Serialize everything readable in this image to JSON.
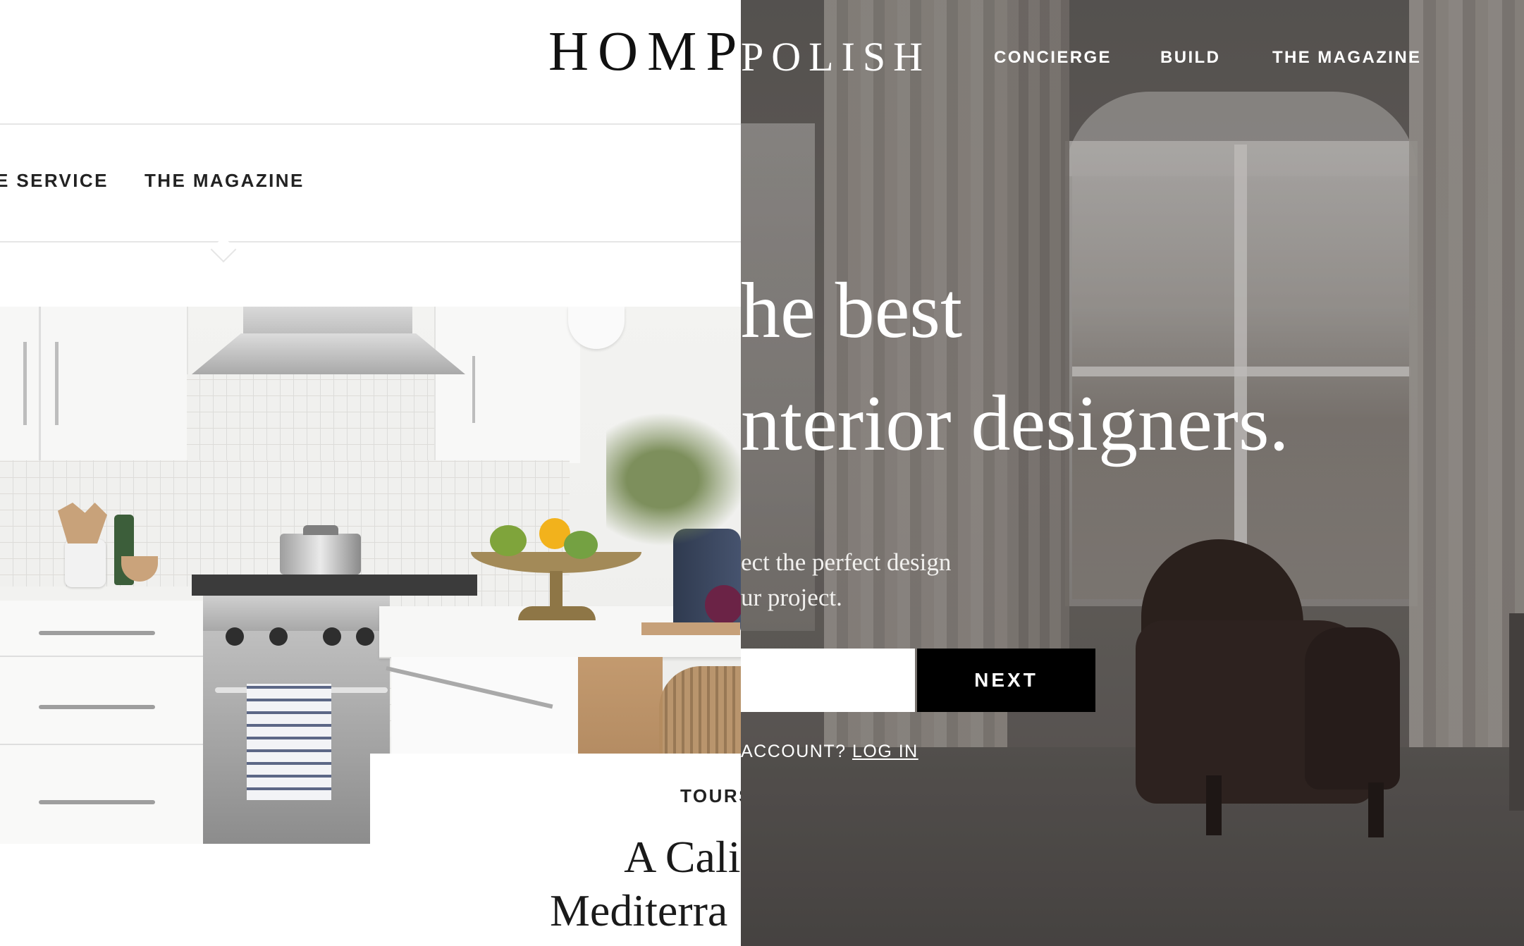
{
  "left_page": {
    "logo": "HOMPOLISH",
    "nav": [
      "E SERVICE",
      "THE MAGAZINE"
    ],
    "article": {
      "category": "TOURS",
      "title_line1": "A California F",
      "title_line2": "Mediterra"
    }
  },
  "right_page": {
    "logo": "POLISH",
    "nav": [
      "CONCIERGE",
      "BUILD",
      "THE MAGAZINE"
    ],
    "headline_line1": "he best",
    "headline_line2": "nterior designers.",
    "subtext_line1": "ect the perfect design",
    "subtext_line2": "ur project.",
    "input_value": "",
    "next_label": "NEXT",
    "account_text": "ACCOUNT?",
    "login_label": "LOG IN"
  },
  "colors": {
    "next_button": "#000000",
    "right_overlay": "#6e6a67",
    "text_dark": "#222222"
  }
}
